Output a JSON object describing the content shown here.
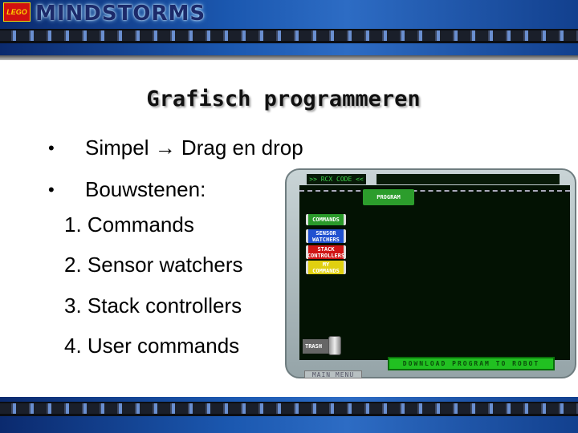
{
  "header": {
    "logo_brand": "LEGO",
    "logo_text": "MINDSTORMS"
  },
  "slide": {
    "title": "Grafisch programmeren",
    "bullets": [
      {
        "marker": "•",
        "text": "Simpel → Drag en drop"
      },
      {
        "marker": "•",
        "text": "Bouwstenen:"
      }
    ],
    "numbered": [
      "1. Commands",
      "2. Sensor watchers",
      "3. Stack controllers",
      "4. User commands"
    ]
  },
  "rcx": {
    "tab": ">> RCX CODE <<",
    "program": "PROGRAM",
    "blocks": [
      {
        "label": "COMMANDS",
        "color": "#2a9a2a"
      },
      {
        "label": "SENSOR WATCHERS",
        "color": "#2050d0"
      },
      {
        "label": "STACK CONTROLLERS",
        "color": "#d01515"
      },
      {
        "label": "MY COMMANDS",
        "color": "#e0d010"
      }
    ],
    "trash": "TRASH",
    "download": "DOWNLOAD PROGRAM TO ROBOT",
    "main_menu": "MAIN MENU"
  }
}
